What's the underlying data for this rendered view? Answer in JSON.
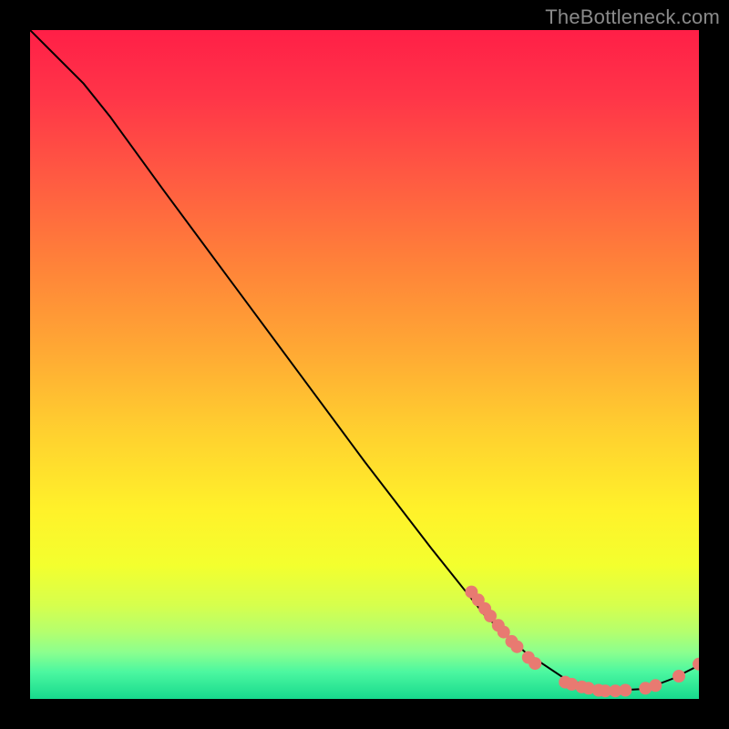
{
  "watermark": "TheBottleneck.com",
  "chart_data": {
    "type": "line",
    "title": "",
    "xlabel": "",
    "ylabel": "",
    "xlim": [
      0,
      100
    ],
    "ylim": [
      0,
      100
    ],
    "curve": [
      {
        "x": 0,
        "y": 100
      },
      {
        "x": 3,
        "y": 97
      },
      {
        "x": 8,
        "y": 92
      },
      {
        "x": 12,
        "y": 87
      },
      {
        "x": 20,
        "y": 76
      },
      {
        "x": 30,
        "y": 62.5
      },
      {
        "x": 40,
        "y": 49
      },
      {
        "x": 50,
        "y": 35.5
      },
      {
        "x": 60,
        "y": 22.5
      },
      {
        "x": 68,
        "y": 12.5
      },
      {
        "x": 74,
        "y": 7
      },
      {
        "x": 80,
        "y": 3
      },
      {
        "x": 86,
        "y": 1.2
      },
      {
        "x": 92,
        "y": 1.5
      },
      {
        "x": 96,
        "y": 3
      },
      {
        "x": 100,
        "y": 5
      }
    ],
    "points": [
      {
        "x": 66,
        "y": 16
      },
      {
        "x": 67,
        "y": 14.8
      },
      {
        "x": 68,
        "y": 13.5
      },
      {
        "x": 68.8,
        "y": 12.4
      },
      {
        "x": 70,
        "y": 11
      },
      {
        "x": 70.8,
        "y": 10
      },
      {
        "x": 72,
        "y": 8.6
      },
      {
        "x": 72.8,
        "y": 7.8
      },
      {
        "x": 74.5,
        "y": 6.2
      },
      {
        "x": 75.5,
        "y": 5.3
      },
      {
        "x": 80,
        "y": 2.5
      },
      {
        "x": 81,
        "y": 2.2
      },
      {
        "x": 82.5,
        "y": 1.8
      },
      {
        "x": 83.5,
        "y": 1.6
      },
      {
        "x": 85,
        "y": 1.3
      },
      {
        "x": 86,
        "y": 1.2
      },
      {
        "x": 87.5,
        "y": 1.2
      },
      {
        "x": 89,
        "y": 1.3
      },
      {
        "x": 92,
        "y": 1.6
      },
      {
        "x": 93.5,
        "y": 2.0
      },
      {
        "x": 97,
        "y": 3.4
      },
      {
        "x": 100,
        "y": 5.2
      }
    ],
    "gradient_stops": [
      {
        "pos": 0.0,
        "color": "#ff1f47"
      },
      {
        "pos": 0.1,
        "color": "#ff3548"
      },
      {
        "pos": 0.22,
        "color": "#ff5a42"
      },
      {
        "pos": 0.35,
        "color": "#ff8239"
      },
      {
        "pos": 0.48,
        "color": "#ffa934"
      },
      {
        "pos": 0.6,
        "color": "#ffd02f"
      },
      {
        "pos": 0.72,
        "color": "#fff22a"
      },
      {
        "pos": 0.8,
        "color": "#f3ff2e"
      },
      {
        "pos": 0.86,
        "color": "#d6ff4d"
      },
      {
        "pos": 0.9,
        "color": "#b4ff6e"
      },
      {
        "pos": 0.93,
        "color": "#8cff8e"
      },
      {
        "pos": 0.96,
        "color": "#4bf7a0"
      },
      {
        "pos": 1.0,
        "color": "#17d98d"
      }
    ]
  }
}
